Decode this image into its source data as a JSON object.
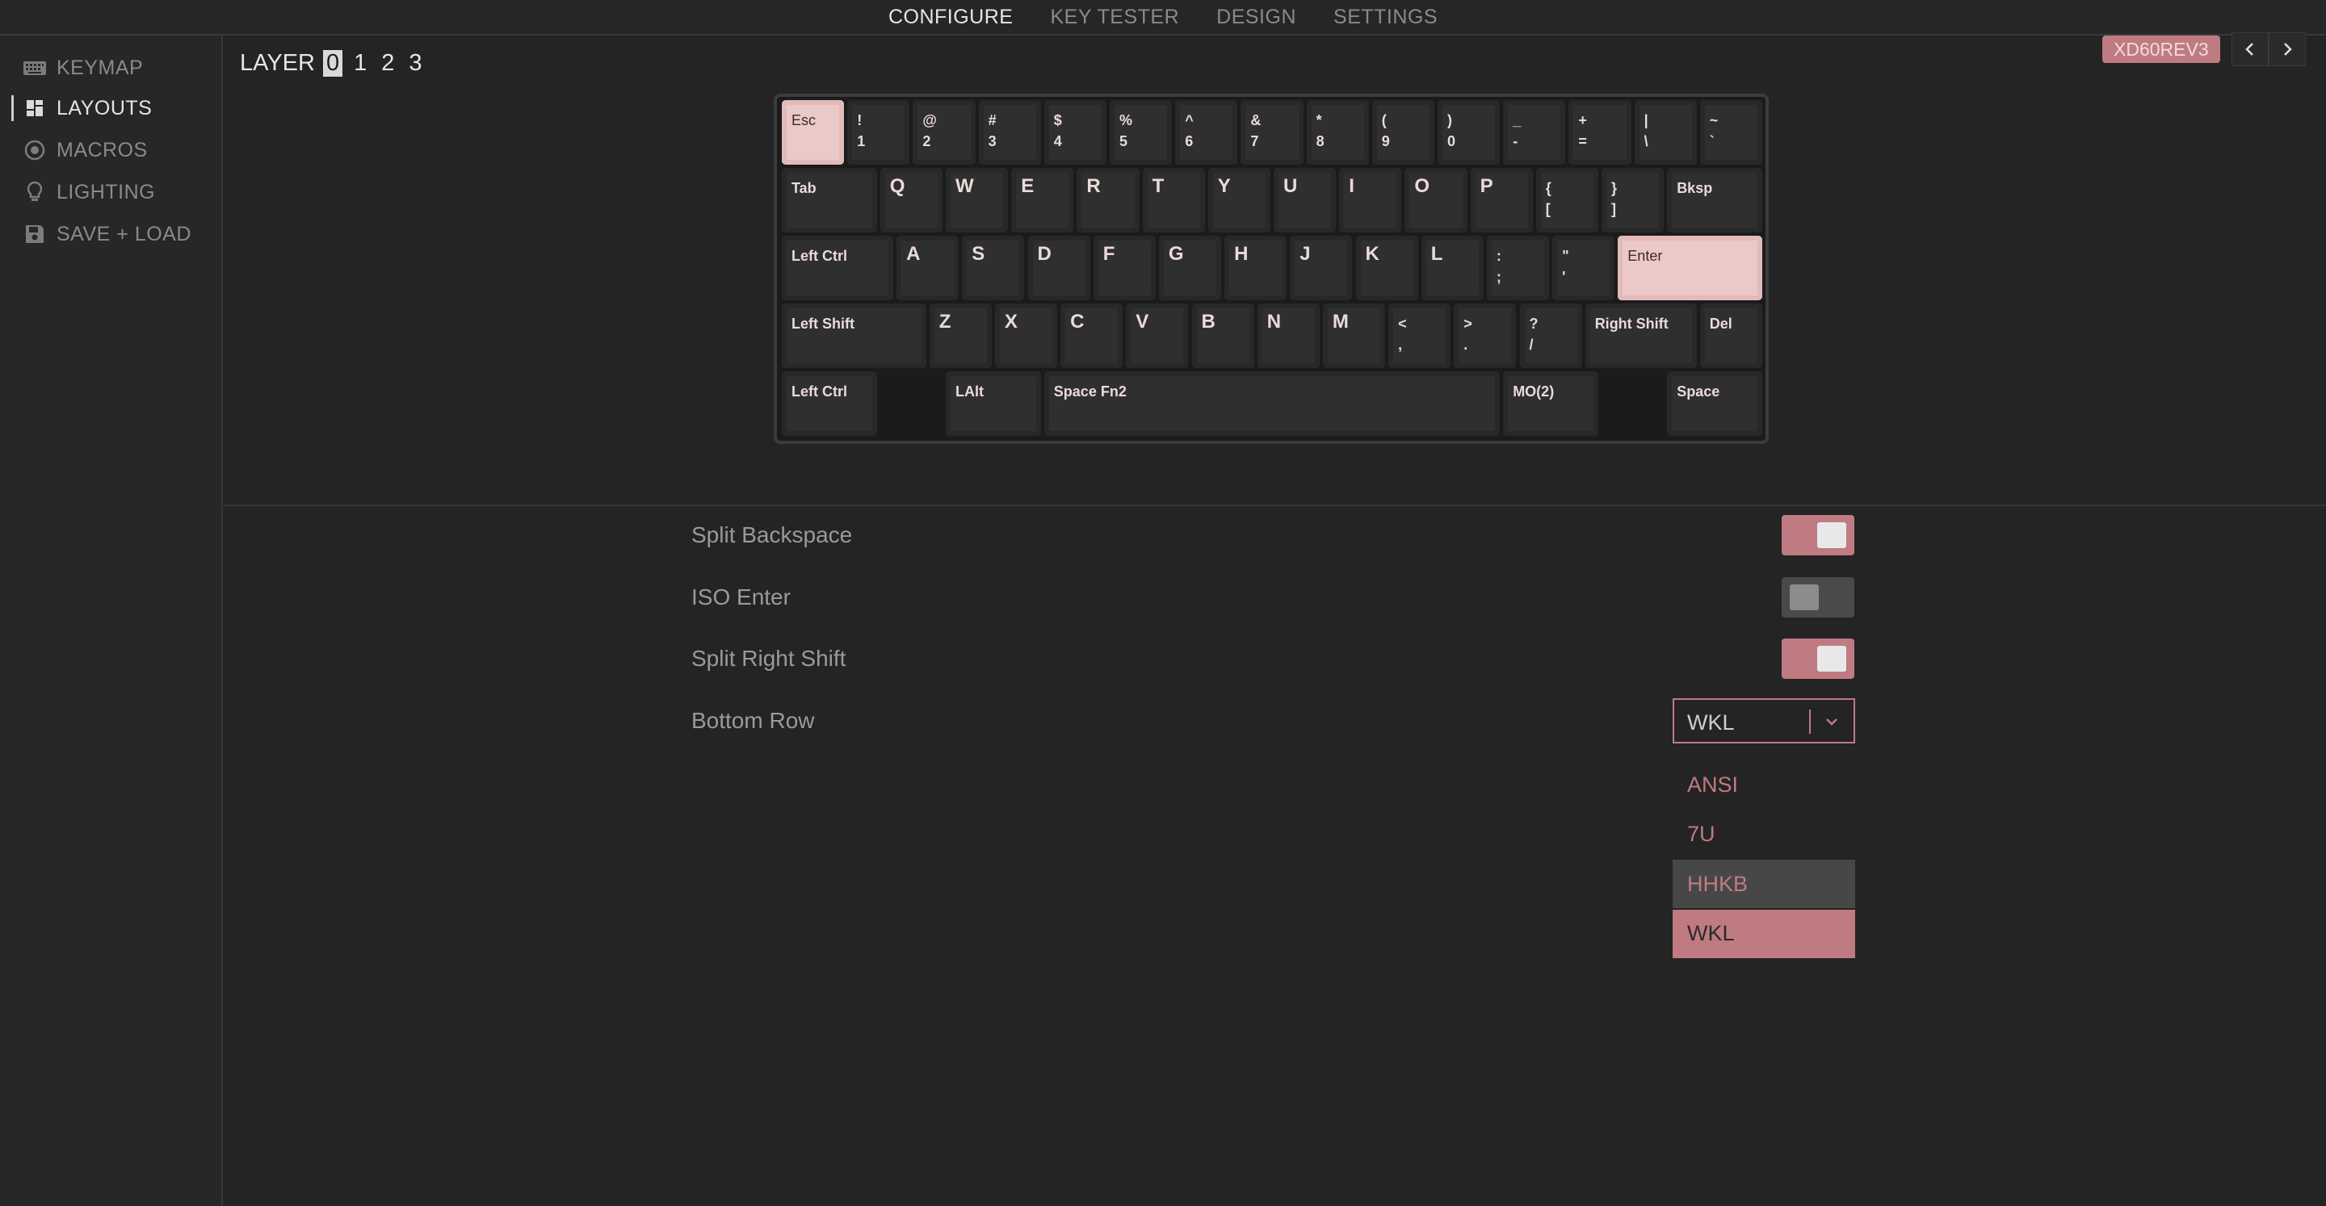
{
  "nav": {
    "tabs": [
      "CONFIGURE",
      "KEY TESTER",
      "DESIGN",
      "SETTINGS"
    ]
  },
  "sidebar": {
    "items": [
      {
        "label": "KEYMAP",
        "icon": "keyboard-icon"
      },
      {
        "label": "LAYOUTS",
        "icon": "layouts-icon"
      },
      {
        "label": "MACROS",
        "icon": "macros-icon"
      },
      {
        "label": "LIGHTING",
        "icon": "lightbulb-icon"
      },
      {
        "label": "SAVE + LOAD",
        "icon": "save-icon"
      }
    ]
  },
  "layers": {
    "label": "LAYER",
    "numbers": [
      "0",
      "1",
      "2",
      "3"
    ]
  },
  "device": {
    "name": "XD60REV3"
  },
  "keyboard": {
    "rows": [
      [
        [
          "Esc"
        ],
        [
          "!\n1"
        ],
        [
          "@\n2"
        ],
        [
          "#\n3"
        ],
        [
          "$\n4"
        ],
        [
          "%\n5"
        ],
        [
          "^\n6"
        ],
        [
          "&\n7"
        ],
        [
          "*\n8"
        ],
        [
          "(\n9"
        ],
        [
          ")\n0"
        ],
        [
          "_\n-"
        ],
        [
          "+\n="
        ],
        [
          "|\n\\"
        ],
        [
          "~\n`"
        ]
      ],
      [
        [
          "Tab"
        ],
        [
          "Q"
        ],
        [
          "W"
        ],
        [
          "E"
        ],
        [
          "R"
        ],
        [
          "T"
        ],
        [
          "Y"
        ],
        [
          "U"
        ],
        [
          "I"
        ],
        [
          "O"
        ],
        [
          "P"
        ],
        [
          "{\n["
        ],
        [
          "}\n]"
        ],
        [
          "Bksp"
        ]
      ],
      [
        [
          "Left Ctrl"
        ],
        [
          "A"
        ],
        [
          "S"
        ],
        [
          "D"
        ],
        [
          "F"
        ],
        [
          "G"
        ],
        [
          "H"
        ],
        [
          "J"
        ],
        [
          "K"
        ],
        [
          "L"
        ],
        [
          ":\n;"
        ],
        [
          "\"\n'"
        ],
        [
          "Enter"
        ]
      ],
      [
        [
          "Left Shift"
        ],
        [
          "Z"
        ],
        [
          "X"
        ],
        [
          "C"
        ],
        [
          "V"
        ],
        [
          "B"
        ],
        [
          "N"
        ],
        [
          "M"
        ],
        [
          "<\n,"
        ],
        [
          ">\n."
        ],
        [
          "?\n/"
        ],
        [
          "Right Shift"
        ],
        [
          "Del"
        ]
      ],
      [
        [
          "Left Ctrl"
        ],
        [
          ""
        ],
        [
          "LAlt"
        ],
        [
          "Space Fn2"
        ],
        [
          "MO(2)"
        ],
        [
          ""
        ],
        [
          "Space"
        ]
      ]
    ]
  },
  "options": {
    "split_backspace": {
      "label": "Split Backspace",
      "on": true
    },
    "iso_enter": {
      "label": "ISO Enter",
      "on": false
    },
    "split_right_shift": {
      "label": "Split Right Shift",
      "on": true
    },
    "bottom_row": {
      "label": "Bottom Row",
      "value": "WKL",
      "options": [
        "ANSI",
        "7U",
        "HHKB",
        "WKL"
      ]
    }
  },
  "colors": {
    "accent": "#c07a82",
    "key_selected": "#ebc9c9"
  }
}
